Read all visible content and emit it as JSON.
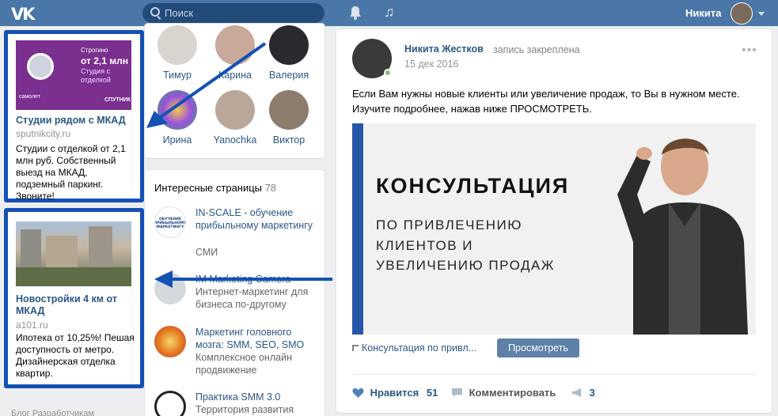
{
  "header": {
    "logo": "VK",
    "search_placeholder": "Поиск",
    "user_name": "Никита"
  },
  "ads": [
    {
      "banner": {
        "line1": "Строгино",
        "line2": "от 2,1 млн",
        "line3": "Студия с отделкой",
        "brand_left": "самолет",
        "brand_right": "СПУТНИК"
      },
      "title": "Студии рядом с МКАД",
      "domain": "sputnikcity.ru",
      "text": "Студии с отделкой от 2,1 млн руб. Собственный выезд на МКАД, подземный паркинг. Звоните!"
    },
    {
      "title": "Новостройки 4 км от МКАД",
      "domain": "a101.ru",
      "text": "Ипотека от 10,25%! Пешая доступность от метро. Дизайнерская отделка квартир."
    }
  ],
  "friends": [
    {
      "name": "Тимур"
    },
    {
      "name": "Карина"
    },
    {
      "name": "Валерия"
    },
    {
      "name": "Ирина"
    },
    {
      "name": "Yanochka"
    },
    {
      "name": "Виктор"
    }
  ],
  "pages": {
    "heading": "Интересные страницы",
    "count": "78",
    "items": [
      {
        "title": "IN-SCALE - обучение прибыльному маркетингу",
        "subtitle": "СМИ"
      },
      {
        "title": "IM Marketing Camera",
        "subtitle": "Интернет-маркетинг для бизнеса по-другому"
      },
      {
        "title": "Маркетинг головного мозга: SMM, SEO, SMO",
        "subtitle": "Комплексное онлайн продвижение"
      },
      {
        "title": "Практика SMM 3.0",
        "subtitle": "Территория развития"
      }
    ]
  },
  "post": {
    "author": "Никита Жестков",
    "pinned_note": "запись закреплена",
    "date": "15 дек 2016",
    "text": "Если Вам нужны новые клиенты или увеличение продаж, то Вы в нужном месте. Изучите подробнее, нажав ниже ПРОСМОТРЕТЬ.",
    "banner": {
      "title": "КОНСУЛЬТАЦИЯ",
      "line1": "ПО ПРИВЛЕЧЕНИЮ",
      "line2": "КЛИЕНТОВ И",
      "line3": "УВЕЛИЧЕНИЮ ПРОДАЖ"
    },
    "link_text": "Консультация по привл...",
    "view_button": "Просмотреть",
    "like_label": "Нравится",
    "like_count": "51",
    "comment_label": "Комментировать",
    "share_count": "3"
  },
  "footer_links": "Блог   Разработчикам",
  "colors": {
    "header": "#4a76a8",
    "link": "#2a5885",
    "highlight_border": "#1451b4",
    "arrow": "#1451b4"
  }
}
